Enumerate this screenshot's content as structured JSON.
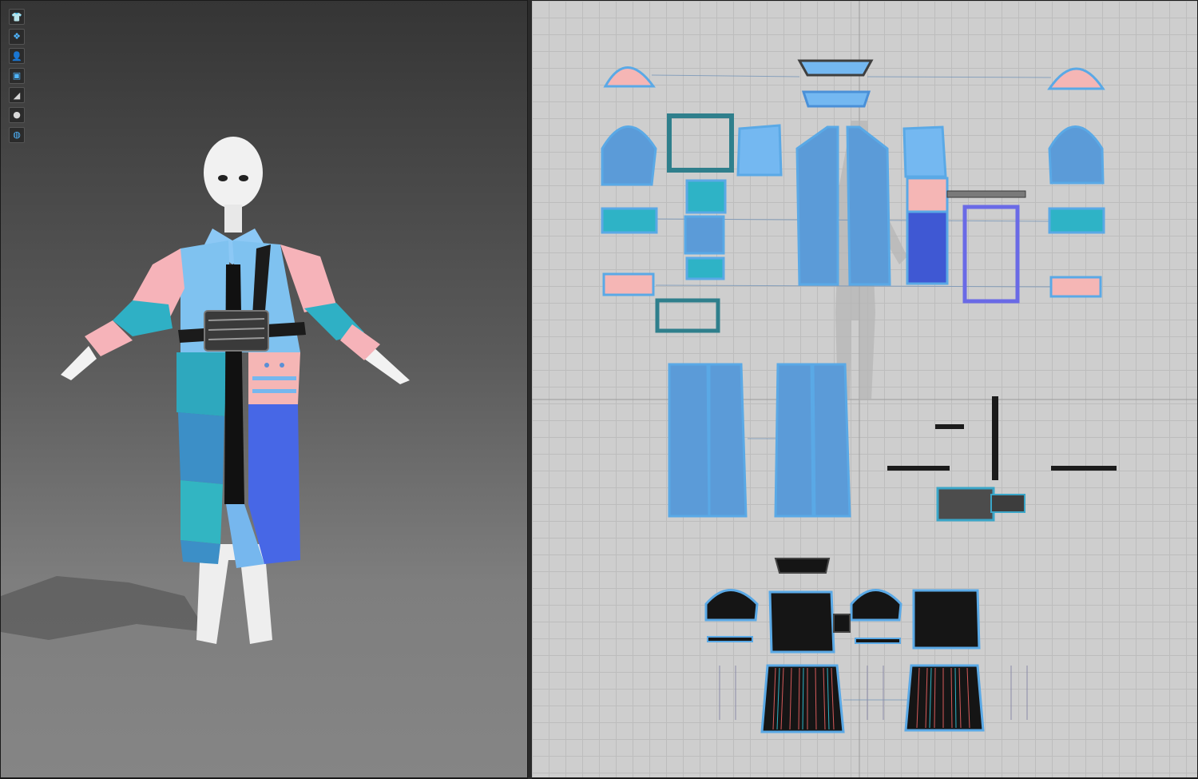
{
  "window": {
    "panes": [
      "3d-garment-view",
      "2d-pattern-view"
    ]
  },
  "toolbar_3d": {
    "tools": [
      {
        "name": "garment-display-icon",
        "glyph": "👕"
      },
      {
        "name": "simulation-icon",
        "glyph": "❖"
      },
      {
        "name": "avatar-display-icon",
        "glyph": "👤"
      },
      {
        "name": "texture-display-icon",
        "glyph": "▣"
      },
      {
        "name": "render-surface-icon",
        "glyph": "◢"
      },
      {
        "name": "avatar-silhouette-icon",
        "glyph": "●"
      },
      {
        "name": "environment-globe-icon",
        "glyph": "◍"
      }
    ]
  },
  "colors": {
    "light_blue": "#74b8f1",
    "mid_blue": "#5b9bd8",
    "pink": "#f5b7b4",
    "teal": "#2eb3c6",
    "royal_blue": "#3f58d3",
    "black_fabric": "#151515",
    "grid_bg": "#cecece",
    "outline": "#5aa9e6"
  }
}
